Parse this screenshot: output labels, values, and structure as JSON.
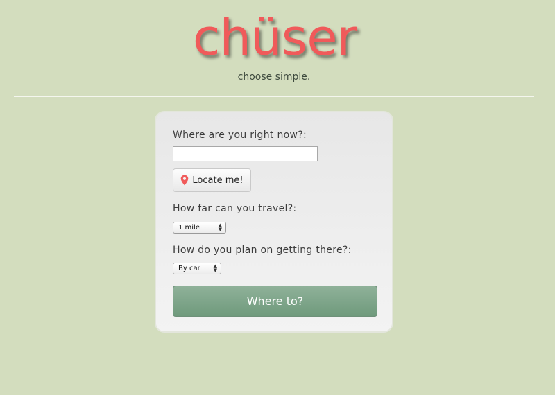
{
  "header": {
    "logo": "chüser",
    "tagline": "choose simple."
  },
  "form": {
    "location_label": "Where are you right now?:",
    "location_value": "",
    "locate_button": "Locate me!",
    "distance_label": "How far can you travel?:",
    "distance_selected": "1 mile",
    "transport_label": "How do you plan on getting there?:",
    "transport_selected": "By car",
    "submit_button": "Where to?"
  },
  "colors": {
    "background": "#d3ddbe",
    "logo": "#f05a5a",
    "submit_button": "#7fa48a",
    "pin_icon": "#f05a5a"
  },
  "icons": {
    "locate_button_icon": "map-pin-icon",
    "select_icon": "updown-arrows-icon"
  }
}
